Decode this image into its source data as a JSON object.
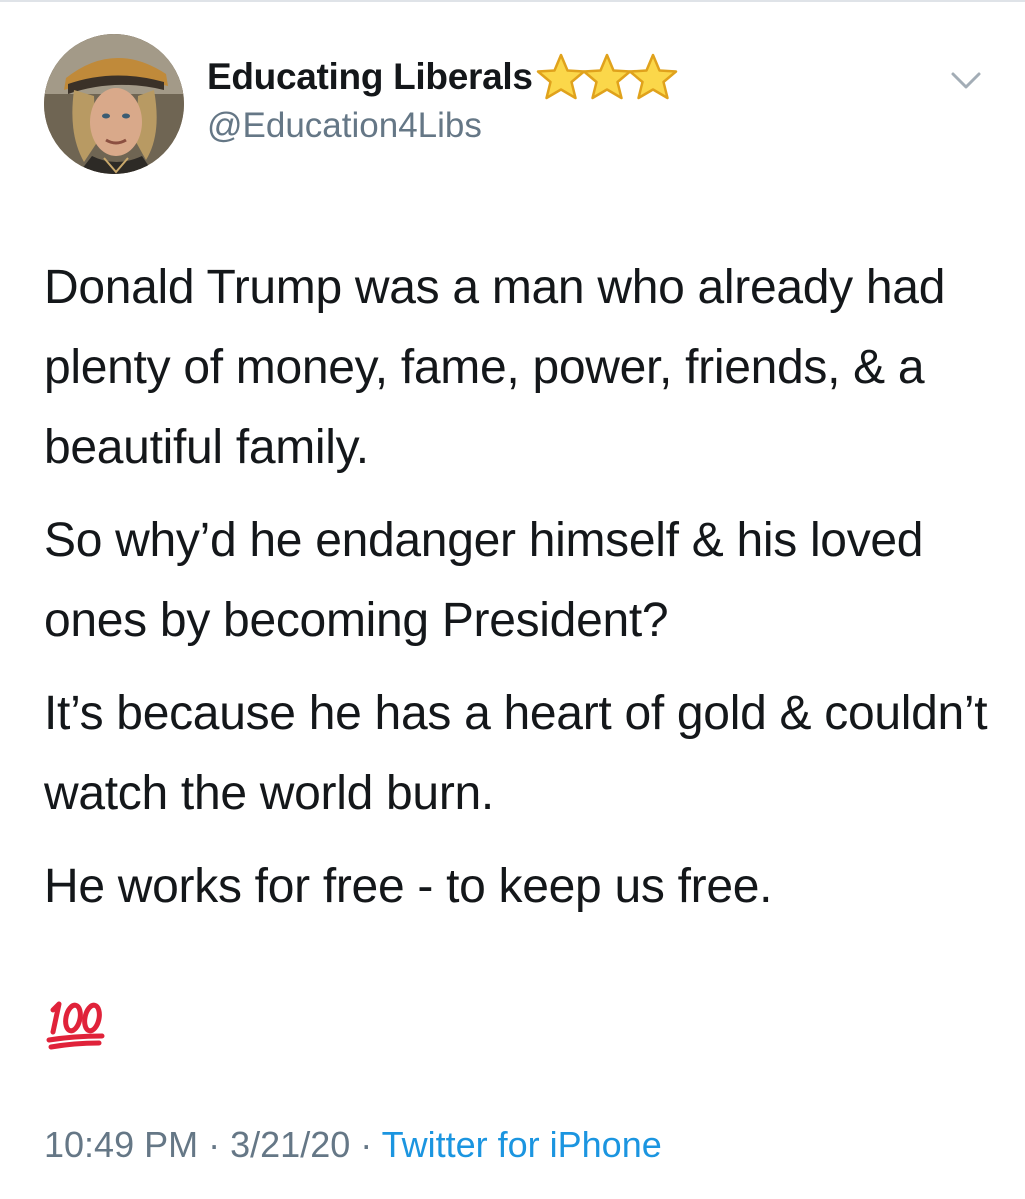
{
  "tweet": {
    "display_name": "Educating Liberals",
    "name_badges": [
      "star-icon",
      "star-icon",
      "star-icon"
    ],
    "handle": "@Education4Libs",
    "paragraphs": [
      "Donald Trump was a man who already had plenty of money, fame, power, friends, & a beautiful family.",
      "So why’d he endanger himself & his loved ones by becoming President?",
      "It’s because he has a heart of gold & couldn’t watch the world burn.",
      "He works for free - to keep us free."
    ],
    "emoji": "💯",
    "time": "10:49 PM",
    "separator": "·",
    "date": "3/21/20",
    "source": "Twitter for iPhone"
  },
  "colors": {
    "text": "#14171a",
    "secondary": "#657786",
    "link": "#1b95e0",
    "star": "#f7c62f",
    "emoji_red": "#e0223a"
  }
}
